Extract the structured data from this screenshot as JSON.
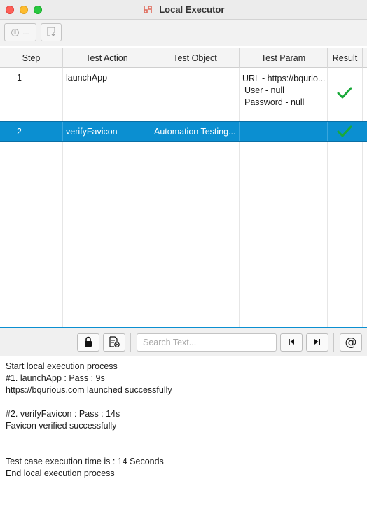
{
  "window": {
    "title": "Local Executor",
    "logo": "bq-logo",
    "controls": [
      "close",
      "minimize",
      "zoom"
    ]
  },
  "toolbar": {
    "pause_label": "...",
    "pause_icon": "pause-icon",
    "export_icon": "export-icon"
  },
  "table": {
    "columns": [
      "Step",
      "Test Action",
      "Test Object",
      "Test Param",
      "Result"
    ],
    "rows": [
      {
        "step": "1",
        "action": "launchApp",
        "object": "",
        "param": [
          "URL - https://bqurio...",
          "User - null",
          "Password - null"
        ],
        "result": "pass",
        "selected": false
      },
      {
        "step": "2",
        "action": "verifyFavicon",
        "object": "Automation Testing...",
        "param": [],
        "result": "pass",
        "selected": true
      }
    ],
    "pass_color": "#1aa93a",
    "selection_color": "#0b8fd1"
  },
  "bottom_toolbar": {
    "search_placeholder": "Search Text...",
    "lock_icon": "lock-icon",
    "export_log_icon": "export-log-icon",
    "prev_icon": "skip-previous-icon",
    "next_icon": "skip-next-icon",
    "at_label": "@"
  },
  "log": {
    "lines": [
      "Start local execution process",
      "#1. launchApp : Pass : 9s",
      "https://bqurious.com launched successfully",
      "",
      "#2. verifyFavicon : Pass : 14s",
      "Favicon verified successfully",
      "",
      "",
      "Test case execution time is : 14 Seconds",
      "End local execution process"
    ]
  }
}
